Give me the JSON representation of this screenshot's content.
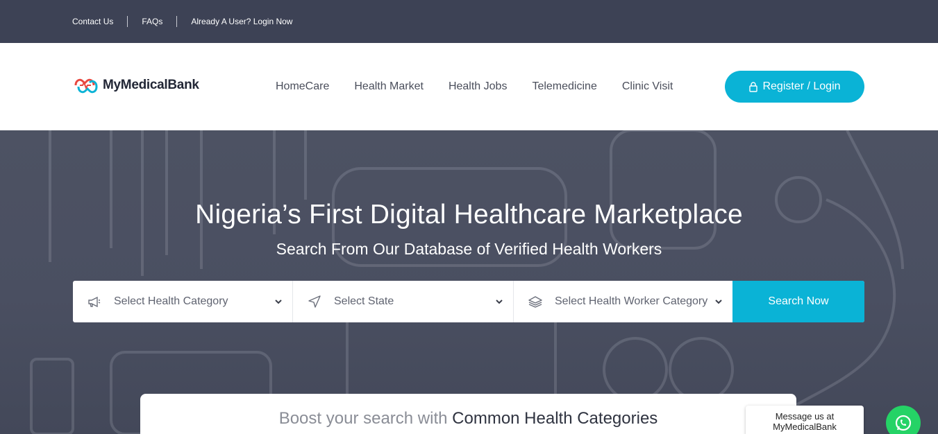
{
  "topbar": {
    "links": [
      "Contact Us",
      "FAQs",
      "Already A User? Login Now"
    ]
  },
  "header": {
    "logo_text": "MyMedicalBank",
    "nav": [
      "HomeCare",
      "Health Market",
      "Health Jobs",
      "Telemedicine",
      "Clinic Visit"
    ],
    "register_label": "Register / Login"
  },
  "hero": {
    "title": "Nigeria’s First Digital Healthcare Marketplace",
    "subtitle": "Search From Our Database of Verified Health Workers",
    "search": {
      "health_category": "Select Health Category",
      "state": "Select State",
      "worker_category": "Select Health Worker Category",
      "button": "Search Now"
    }
  },
  "card": {
    "lead": "Boost your search with",
    "emphasis": "Common Health Categories"
  },
  "whatsapp": {
    "message": "Message us at MyMedicalBank"
  },
  "colors": {
    "accent": "#0ab3d6",
    "topbar": "#3d4255",
    "whatsapp": "#25d366"
  }
}
